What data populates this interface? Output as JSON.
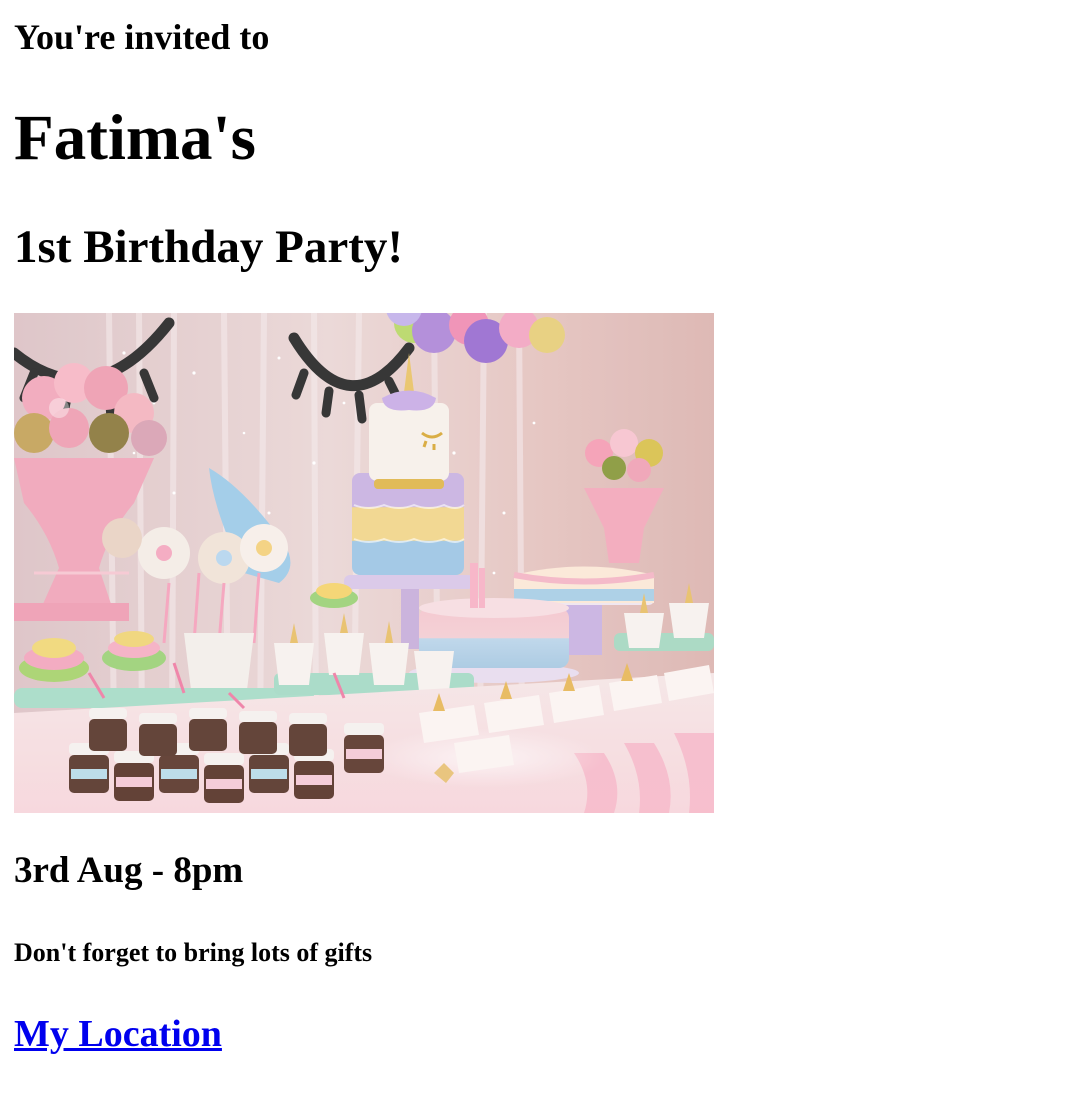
{
  "invite": {
    "intro": "You're invited to",
    "name": "Fatima's",
    "event": "1st Birthday Party!",
    "image_alt": "Unicorn-themed birthday party dessert table with cakes, cupcakes, balloons and flowers",
    "datetime": "3rd Aug - 8pm",
    "note": "Don't forget to bring lots of gifts",
    "location_link": "My Location"
  },
  "colors": {
    "link": "#0000ee",
    "text": "#000000",
    "background": "#ffffff"
  }
}
